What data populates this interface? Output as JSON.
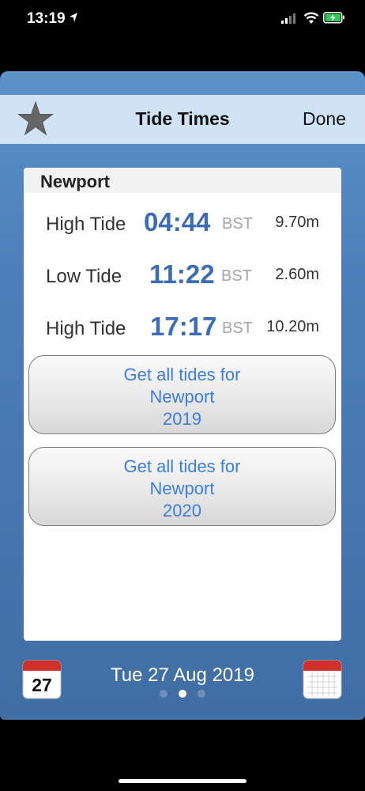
{
  "status_bar": {
    "time": "13:19"
  },
  "header": {
    "title": "Tide Times",
    "done_label": "Done"
  },
  "location": "Newport",
  "tides": [
    {
      "type": "High Tide",
      "time": "04:44",
      "tz": "BST",
      "height": "9.70m"
    },
    {
      "type": "Low Tide",
      "time": "11:22",
      "tz": "BST",
      "height": "2.60m"
    },
    {
      "type": "High Tide",
      "time": "17:17",
      "tz": "BST",
      "height": "10.20m"
    }
  ],
  "buttons": [
    {
      "line1": "Get all tides for",
      "line2": "Newport",
      "line3": "2019"
    },
    {
      "line1": "Get all tides for",
      "line2": "Newport",
      "line3": "2020"
    }
  ],
  "footer": {
    "date": "Tue 27 Aug 2019",
    "calendar_day": "27",
    "page_count": 3,
    "current_page": 2
  },
  "colors": {
    "accent_blue": "#3d6cb7",
    "button_text": "#3c7ee0",
    "navbar_bg": "#cfe3f5",
    "calendar_red": "#d0302a"
  }
}
